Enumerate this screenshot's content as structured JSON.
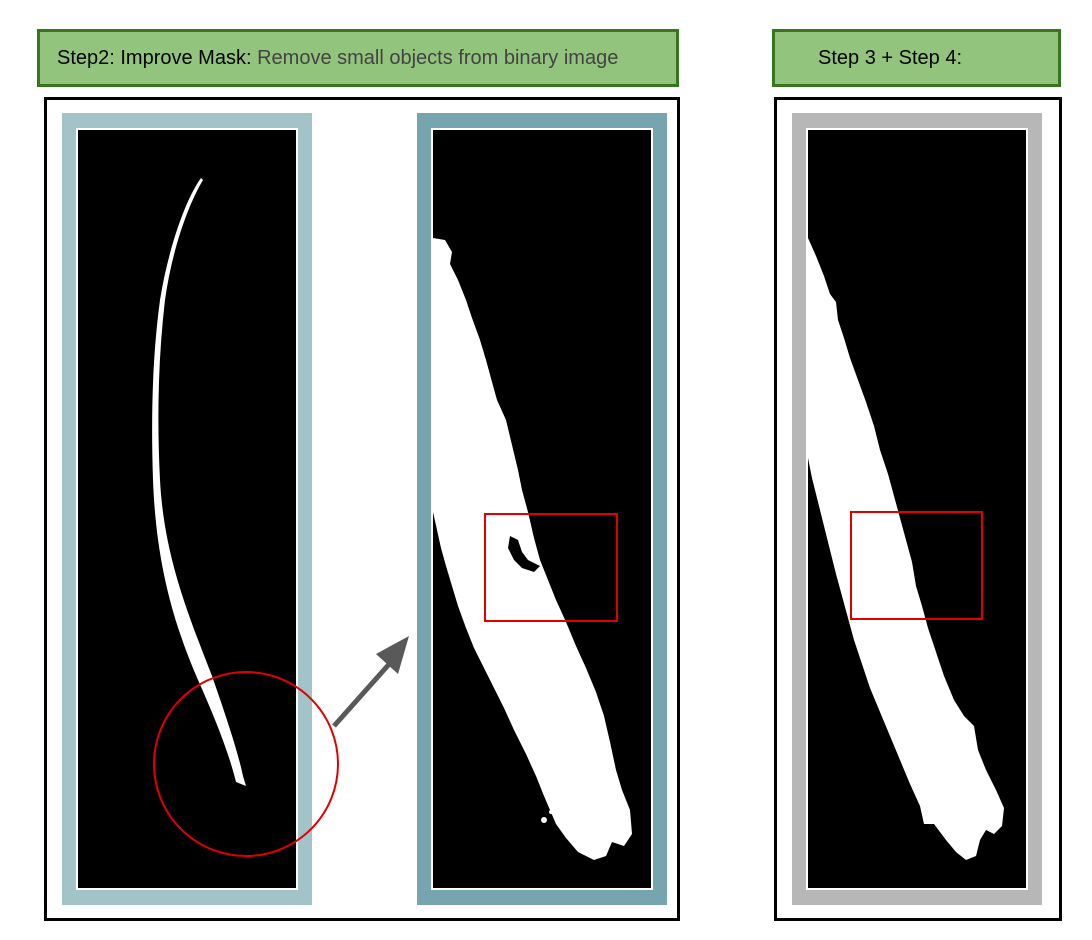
{
  "step2": {
    "prefix": "Step2: Improve Mask:",
    "description": "Remove small objects from binary image"
  },
  "step34": {
    "title": "Step 3 + Step 4:"
  },
  "colors": {
    "label_fill": "#93c47d",
    "label_border": "#38761d",
    "frame_light_teal": "#a2c4c9",
    "frame_dark_teal": "#76a5af",
    "frame_gray": "#b7b7b7",
    "highlight_red": "#e00000",
    "arrow_gray": "#595959"
  }
}
